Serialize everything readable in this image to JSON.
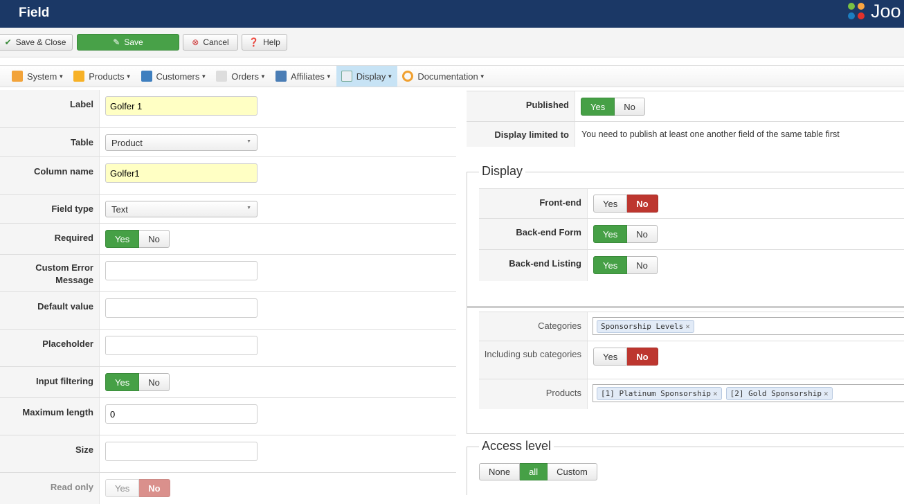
{
  "header": {
    "title": "Field",
    "logo_text": "Joo"
  },
  "toolbar": {
    "save_close": "Save & Close",
    "save": "Save",
    "cancel": "Cancel",
    "help": "Help"
  },
  "menu": [
    {
      "label": "System",
      "icon": "tools-icon"
    },
    {
      "label": "Products",
      "icon": "box-icon"
    },
    {
      "label": "Customers",
      "icon": "users-icon"
    },
    {
      "label": "Orders",
      "icon": "document-icon"
    },
    {
      "label": "Affiliates",
      "icon": "affiliates-icon"
    },
    {
      "label": "Display",
      "icon": "display-icon",
      "active": true
    },
    {
      "label": "Documentation",
      "icon": "lifebuoy-icon"
    }
  ],
  "form": {
    "label": {
      "label": "Label",
      "value": "Golfer 1"
    },
    "table": {
      "label": "Table",
      "value": "Product"
    },
    "column_name": {
      "label": "Column name",
      "value": "Golfer1"
    },
    "field_type": {
      "label": "Field type",
      "value": "Text"
    },
    "required": {
      "label": "Required",
      "yes": "Yes",
      "no": "No",
      "value": "Yes"
    },
    "custom_error": {
      "label": "Custom Error Message",
      "value": ""
    },
    "default_value": {
      "label": "Default value",
      "value": ""
    },
    "placeholder": {
      "label": "Placeholder",
      "value": ""
    },
    "input_filtering": {
      "label": "Input filtering",
      "yes": "Yes",
      "no": "No",
      "value": "Yes"
    },
    "max_length": {
      "label": "Maximum length",
      "value": "0"
    },
    "size": {
      "label": "Size",
      "value": ""
    },
    "read_only": {
      "label": "Read only",
      "yes": "Yes",
      "no": "No",
      "value": "No"
    }
  },
  "right": {
    "published": {
      "label": "Published",
      "yes": "Yes",
      "no": "No",
      "value": "Yes"
    },
    "display_limited": {
      "label": "Display limited to",
      "text": "You need to publish at least one another field of the same table first"
    },
    "display": {
      "legend": "Display",
      "front_end": {
        "label": "Front-end",
        "yes": "Yes",
        "no": "No",
        "value": "No"
      },
      "backend_form": {
        "label": "Back-end Form",
        "yes": "Yes",
        "no": "No",
        "value": "Yes"
      },
      "backend_listing": {
        "label": "Back-end Listing",
        "yes": "Yes",
        "no": "No",
        "value": "Yes"
      }
    },
    "categories": {
      "label": "Categories",
      "chips": [
        "Sponsorship Levels"
      ]
    },
    "including_sub": {
      "label": "Including sub categories",
      "yes": "Yes",
      "no": "No",
      "value": "No"
    },
    "products": {
      "label": "Products",
      "chips": [
        "[1] Platinum Sponsorship",
        "[2] Gold Sponsorship"
      ]
    },
    "access": {
      "legend": "Access level",
      "options": [
        "None",
        "all",
        "Custom"
      ],
      "value": "all"
    }
  }
}
